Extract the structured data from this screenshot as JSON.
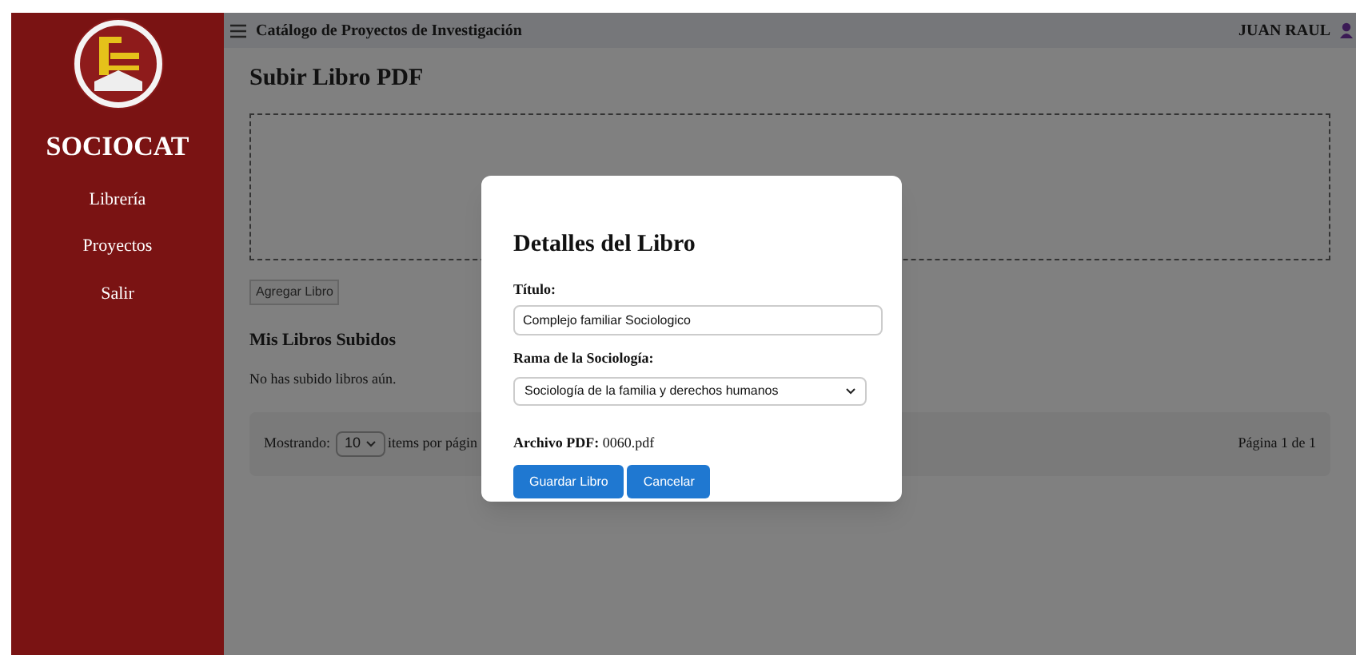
{
  "sidebar": {
    "brand": "SOCIOCAT",
    "items": [
      {
        "label": "Librería"
      },
      {
        "label": "Proyectos"
      },
      {
        "label": "Salir"
      }
    ]
  },
  "topbar": {
    "title": "Catálogo de Proyectos de Investigación",
    "user": "JUAN RAUL"
  },
  "page": {
    "heading": "Subir Libro PDF",
    "add_button": "Agregar Libro",
    "list_heading": "Mis Libros Subidos",
    "empty_text": "No has subido libros aún.",
    "pagination": {
      "showing_label": "Mostrando:",
      "per_page": "10",
      "per_page_suffix": "items por págin",
      "page_info": "Página 1 de 1"
    }
  },
  "modal": {
    "title": "Detalles del Libro",
    "title_label": "Título:",
    "title_value": "Complejo familiar Sociologico",
    "branch_label": "Rama de la Sociología:",
    "branch_value": "Sociología de la familia y derechos humanos",
    "file_label": "Archivo PDF:",
    "file_value": "0060.pdf",
    "buttons": [
      "Guardar Libro",
      "Cancelar"
    ]
  }
}
